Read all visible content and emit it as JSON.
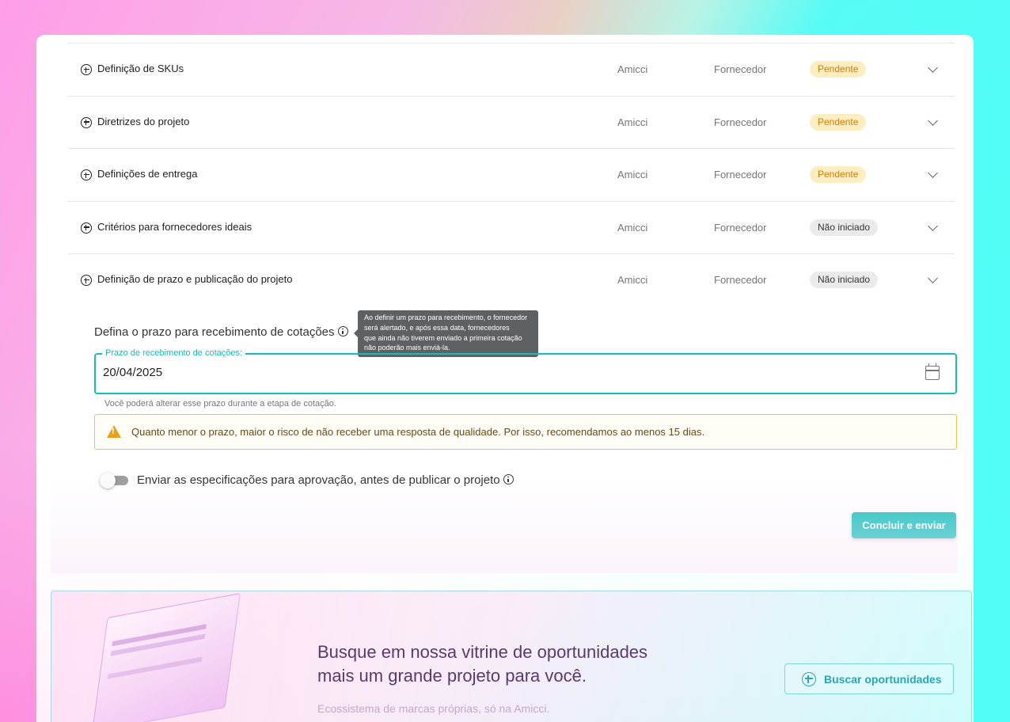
{
  "sections": [
    {
      "title": "Definição de SKUs",
      "owner": "Amicci",
      "responsible": "Fornecedor",
      "status": "Pendente"
    },
    {
      "title": "Diretrizes do projeto",
      "owner": "Amicci",
      "responsible": "Fornecedor",
      "status": "Pendente"
    },
    {
      "title": "Definições de entrega",
      "owner": "Amicci",
      "responsible": "Fornecedor",
      "status": "Pendente"
    },
    {
      "title": "Critérios para fornecedores ideais",
      "owner": "Amicci",
      "responsible": "Fornecedor",
      "status": "Não iniciado"
    },
    {
      "title": "Definição de prazo e publicação do projeto",
      "owner": "Amicci",
      "responsible": "Fornecedor",
      "status": "Não iniciado"
    }
  ],
  "deadline": {
    "heading": "Defina o prazo para recebimento de cotações",
    "tooltip_lines": [
      "Ao definir um prazo para recebimento, o fornecedor",
      "será alertado, e após essa data, fornecedores",
      "que ainda não tiverem enviado a primeira cotação",
      "não poderão mais enviá-la."
    ],
    "field_label": "Prazo de recebimento de cotações:",
    "field_value": "20/04/2025",
    "helper_text": "Você poderá alterar esse prazo durante a etapa de cotação.",
    "warning_text": "Quanto menor o prazo, maior o risco de não receber uma resposta de qualidade. Por isso, recomendamos ao menos 15 dias."
  },
  "approval_toggle": {
    "label": "Enviar as especificações para aprovação, antes de publicar o projeto",
    "checked": false
  },
  "submit_label": "Concluir e enviar",
  "promo": {
    "title_lines": [
      "Busque em nossa vitrine de oportunidades",
      "mais um grande projeto para você."
    ],
    "subtitle": "Ecossistema de marcas próprias, só na Amicci.",
    "button_label": "Buscar oportunidades"
  },
  "colors": {
    "accent": "#16c0bc",
    "pending_bg": "#ffedc2",
    "pending_text": "#d27d00",
    "not_started_bg": "#ebebeb",
    "warning_border": "#f1c14e"
  }
}
